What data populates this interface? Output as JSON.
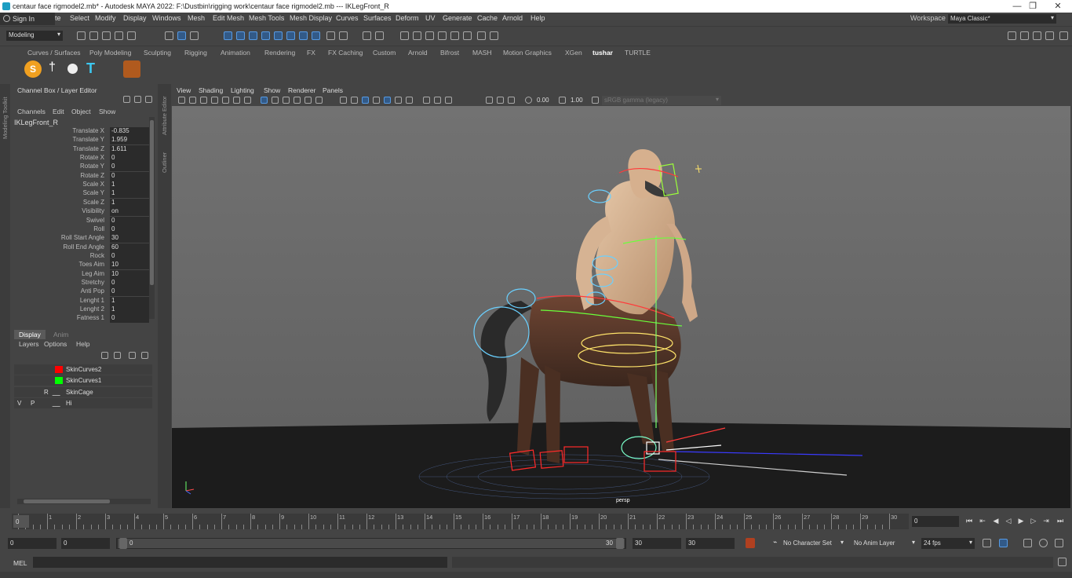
{
  "titlebar": {
    "title": "centaur face rigmodel2.mb* - Autodesk MAYA 2022: F:\\Dustbin\\rigging work\\centaur face rigmodel2.mb  ---  IKLegFront_R",
    "minimize": "—",
    "restore": "❐",
    "close": "✕"
  },
  "menubar": {
    "sign_in": "Sign In",
    "items": [
      "te",
      "Select",
      "Modify",
      "Display",
      "Windows",
      "Mesh",
      "Edit Mesh",
      "Mesh Tools",
      "Mesh Display",
      "Curves",
      "Surfaces",
      "Deform",
      "UV",
      "Generate",
      "Cache",
      "Arnold",
      "Help"
    ],
    "workspace_label": "Workspace :",
    "workspace_value": "Maya Classic*"
  },
  "statusline": {
    "mode": "Modeling"
  },
  "shelf": {
    "tabs": [
      "Curves / Surfaces",
      "Poly Modeling",
      "Sculpting",
      "Rigging",
      "Animation",
      "Rendering",
      "FX",
      "FX Caching",
      "Custom",
      "Arnold",
      "Bifrost",
      "MASH",
      "Motion Graphics",
      "XGen",
      "tushar",
      "TURTLE"
    ],
    "active_tab": "tushar"
  },
  "side_tabs": {
    "left": "Modeling Toolkit",
    "attr1": "Attribute Editor",
    "attr2": "Outliner"
  },
  "channel_box": {
    "header": "Channel Box / Layer Editor",
    "menus": [
      "Channels",
      "Edit",
      "Object",
      "Show"
    ],
    "object": "IKLegFront_R",
    "attributes": [
      {
        "label": "Translate X",
        "value": "-0.835"
      },
      {
        "label": "Translate Y",
        "value": "1.959"
      },
      {
        "label": "Translate Z",
        "value": "1.611"
      },
      {
        "label": "Rotate X",
        "value": "0"
      },
      {
        "label": "Rotate Y",
        "value": "0"
      },
      {
        "label": "Rotate Z",
        "value": "0"
      },
      {
        "label": "Scale X",
        "value": "1"
      },
      {
        "label": "Scale Y",
        "value": "1"
      },
      {
        "label": "Scale Z",
        "value": "1"
      },
      {
        "label": "Visibility",
        "value": "on"
      },
      {
        "label": "Swivel",
        "value": "0"
      },
      {
        "label": "Roll",
        "value": "0"
      },
      {
        "label": "Roll Start Angle",
        "value": "30"
      },
      {
        "label": "Roll End Angle",
        "value": "60"
      },
      {
        "label": "Rock",
        "value": "0"
      },
      {
        "label": "Toes Aim",
        "value": "10"
      },
      {
        "label": "Leg Aim",
        "value": "10"
      },
      {
        "label": "Stretchy",
        "value": "0"
      },
      {
        "label": "Anti Pop",
        "value": "0"
      },
      {
        "label": "Lenght 1",
        "value": "1"
      },
      {
        "label": "Lenght 2",
        "value": "1"
      },
      {
        "label": "Fatness 1",
        "value": "0"
      }
    ]
  },
  "layer_editor": {
    "tabs": [
      "Display",
      "Anim"
    ],
    "menus": [
      "Layers",
      "Options",
      "Help"
    ],
    "layers": [
      {
        "v": "",
        "p": "",
        "r": "",
        "color": "#ff0000",
        "name": "SkinCurves2"
      },
      {
        "v": "",
        "p": "",
        "r": "",
        "color": "#00ff00",
        "name": "SkinCurves1"
      },
      {
        "v": "",
        "p": "",
        "r": "R",
        "color": "",
        "name": "SkinCage"
      },
      {
        "v": "V",
        "p": "P",
        "r": "",
        "color": "",
        "name": "Hi"
      }
    ]
  },
  "viewport": {
    "menus": [
      "View",
      "Shading",
      "Lighting",
      "Show",
      "Renderer",
      "Panels"
    ],
    "exposure": "0.00",
    "gamma": "1.00",
    "color_space": "sRGB gamma (legacy)",
    "camera": "persp"
  },
  "timeline": {
    "ticks": [
      "0",
      "1",
      "2",
      "3",
      "4",
      "5",
      "6",
      "7",
      "8",
      "9",
      "10",
      "11",
      "12",
      "13",
      "14",
      "15",
      "16",
      "17",
      "18",
      "19",
      "20",
      "21",
      "22",
      "23",
      "24",
      "25",
      "26",
      "27",
      "28",
      "29",
      "30"
    ],
    "current_frame": "0"
  },
  "range": {
    "start": "0",
    "playback_start": "0",
    "slider_start": "0",
    "slider_end": "30",
    "playback_end": "30",
    "end": "30",
    "character_set": "No Character Set",
    "anim_layer": "No Anim Layer",
    "fps": "24 fps"
  },
  "cmdline": {
    "label": "MEL"
  },
  "colors": {
    "panel": "#444444",
    "field": "#2b2b2b",
    "viewport_bg": "#6e6e6e",
    "accent": "#5aa9ff"
  }
}
